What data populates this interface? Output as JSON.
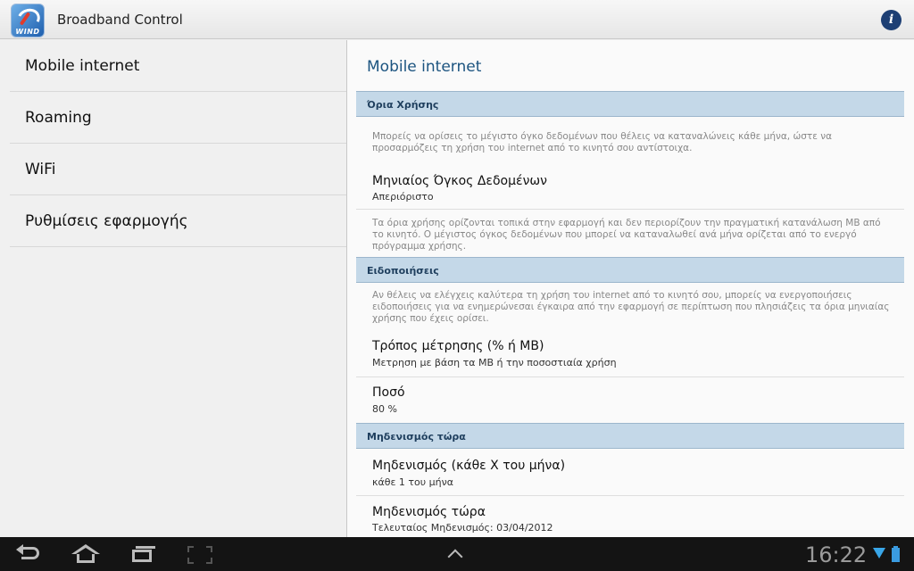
{
  "app": {
    "title": "Broadband Control",
    "icon_text": "WIND",
    "info_glyph": "i"
  },
  "sidebar": {
    "items": [
      {
        "label": "Mobile internet"
      },
      {
        "label": "Roaming"
      },
      {
        "label": "WiFi"
      },
      {
        "label": "Ρυθμίσεις εφαρμογής"
      }
    ]
  },
  "main": {
    "title": "Mobile internet",
    "sections": [
      {
        "header": "Όρια Χρήσης",
        "description": "Μπορείς να ορίσεις το μέγιστο όγκο δεδομένων που θέλεις να καταναλώνεις κάθε μήνα, ώστε να προσαρμόζεις τη χρήση του internet από το κινητό σου αντίστοιχα.",
        "prefs": [
          {
            "title": "Μηνιαίος Όγκος Δεδομένων",
            "summary": "Απεριόριστο"
          }
        ],
        "footer": "Τα όρια χρήσης ορίζονται τοπικά στην εφαρμογή και δεν περιορίζουν την πραγματική κατανάλωση MB από το κινητό. Ο μέγιστος όγκος δεδομένων που μπορεί να καταναλωθεί ανά μήνα ορίζεται από το ενεργό πρόγραμμα χρήσης."
      },
      {
        "header": "Ειδοποιήσεις",
        "description": "Αν θέλεις να ελέγχεις καλύτερα τη χρήση του internet από το κινητό σου, μπορείς να ενεργοποιήσεις ειδοποιήσεις για να ενημερώνεσαι έγκαιρα από την εφαρμογή σε περίπτωση που πλησιάζεις τα όρια μηνιαίας χρήσης που έχεις ορίσει.",
        "prefs": [
          {
            "title": "Τρόπος μέτρησης (% ή MB)",
            "summary": "Μετρηση με βάση τα MB ή την ποσοστιαία χρήση"
          },
          {
            "title": "Ποσό",
            "summary": "80 %"
          }
        ]
      },
      {
        "header": "Μηδενισμός τώρα",
        "prefs": [
          {
            "title": "Μηδενισμός (κάθε Χ του μήνα)",
            "summary": "κάθε 1 του μήνα"
          },
          {
            "title": "Μηδενισμός τώρα",
            "summary": "Τελευταίος Μηδενισμός: 03/04/2012"
          }
        ]
      }
    ]
  },
  "system_bar": {
    "clock": "16:22",
    "colors": {
      "status_accent": "#39a6e8"
    }
  }
}
